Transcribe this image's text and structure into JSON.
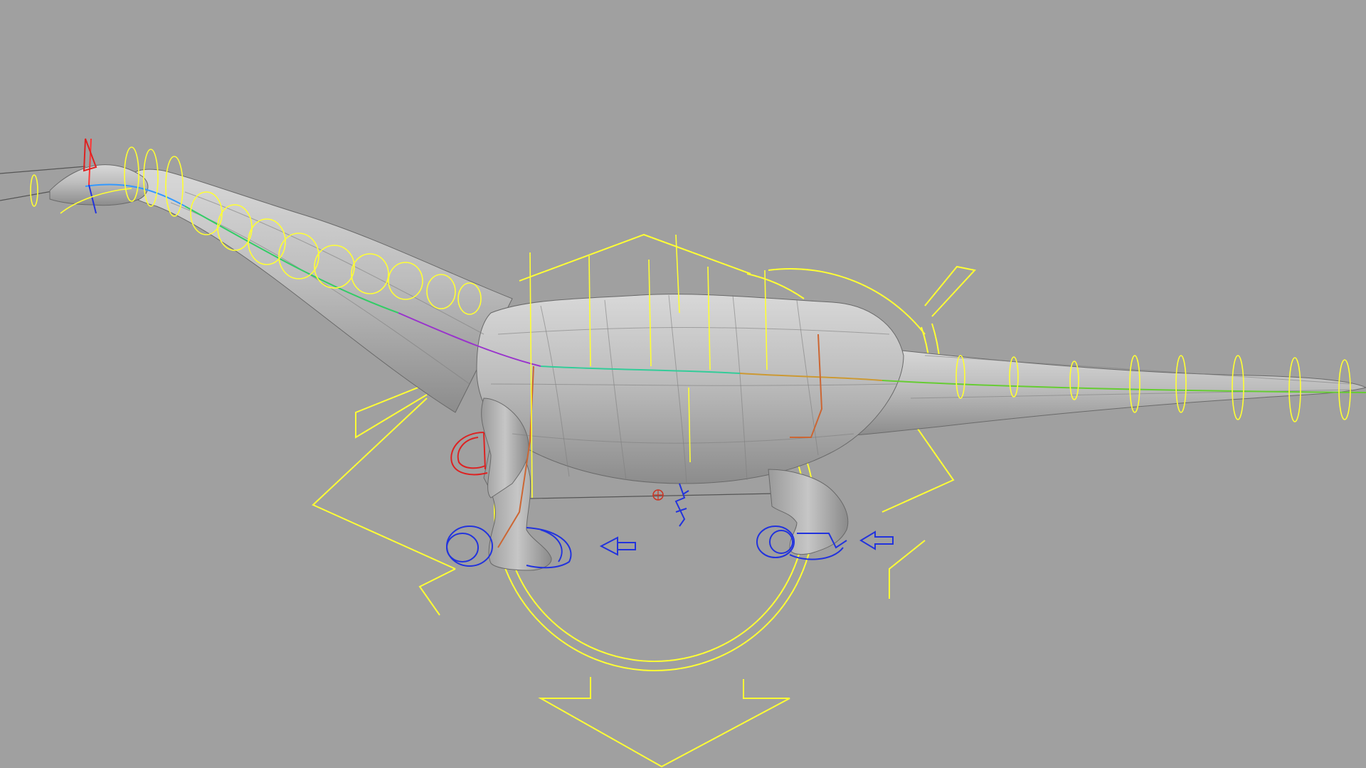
{
  "viewport": {
    "background": "#a0a0a0",
    "mesh_color": "#c4c4c4",
    "control_colors": {
      "main": "#ffff33",
      "ik": "#2233dd",
      "shoulder": "#dd2222"
    }
  },
  "icons": {
    "front_foot_arrow": "left-arrow-icon",
    "back_foot_arrow": "left-arrow-icon",
    "center_of_mass": "crosshair-icon"
  }
}
